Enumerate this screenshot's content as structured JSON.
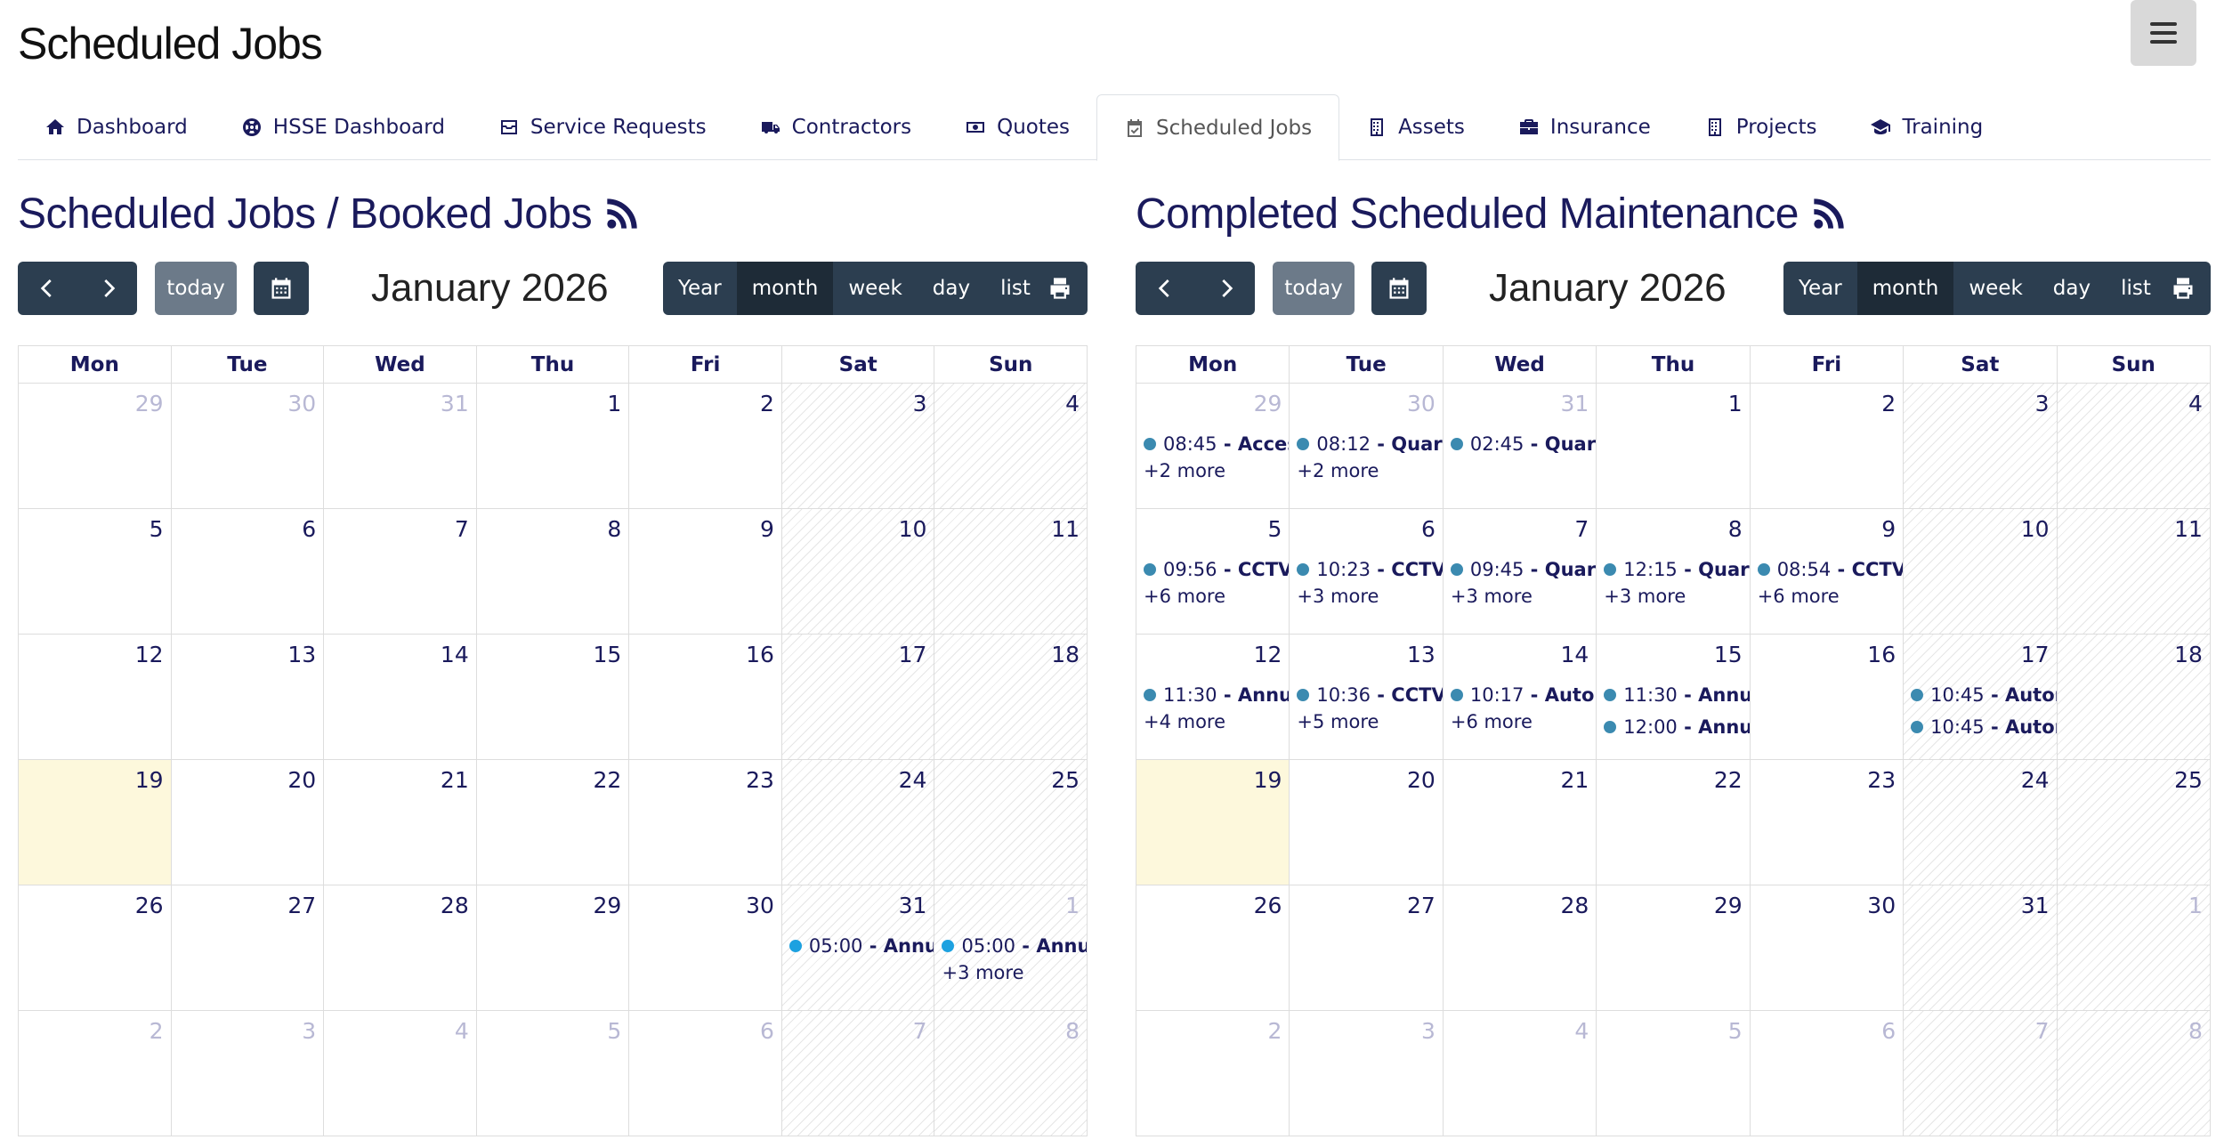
{
  "page": {
    "title": "Scheduled Jobs"
  },
  "nav": {
    "tabs": [
      {
        "label": "Dashboard",
        "icon": "home-icon"
      },
      {
        "label": "HSSE Dashboard",
        "icon": "lifebuoy-icon"
      },
      {
        "label": "Service Requests",
        "icon": "inbox-tray-icon"
      },
      {
        "label": "Contractors",
        "icon": "truck-icon"
      },
      {
        "label": "Quotes",
        "icon": "money-bill-icon"
      },
      {
        "label": "Scheduled Jobs",
        "icon": "calendar-check-icon",
        "active": true
      },
      {
        "label": "Assets",
        "icon": "building-icon"
      },
      {
        "label": "Insurance",
        "icon": "briefcase-icon"
      },
      {
        "label": "Projects",
        "icon": "building-icon"
      },
      {
        "label": "Training",
        "icon": "graduation-cap-icon"
      }
    ]
  },
  "calendars": [
    {
      "heading": "Scheduled Jobs / Booked Jobs",
      "today_label": "today",
      "title": "January 2026",
      "views": [
        "Year",
        "month",
        "week",
        "day",
        "list"
      ],
      "active_view": "month",
      "days_of_week": [
        "Mon",
        "Tue",
        "Wed",
        "Thu",
        "Fri",
        "Sat",
        "Sun"
      ],
      "weeks": [
        [
          {
            "n": "29",
            "o": true
          },
          {
            "n": "30",
            "o": true
          },
          {
            "n": "31",
            "o": true
          },
          {
            "n": "1"
          },
          {
            "n": "2"
          },
          {
            "n": "3"
          },
          {
            "n": "4"
          }
        ],
        [
          {
            "n": "5"
          },
          {
            "n": "6"
          },
          {
            "n": "7"
          },
          {
            "n": "8"
          },
          {
            "n": "9"
          },
          {
            "n": "10"
          },
          {
            "n": "11"
          }
        ],
        [
          {
            "n": "12"
          },
          {
            "n": "13"
          },
          {
            "n": "14"
          },
          {
            "n": "15"
          },
          {
            "n": "16"
          },
          {
            "n": "17"
          },
          {
            "n": "18"
          }
        ],
        [
          {
            "n": "19",
            "today": true
          },
          {
            "n": "20"
          },
          {
            "n": "21"
          },
          {
            "n": "22"
          },
          {
            "n": "23"
          },
          {
            "n": "24"
          },
          {
            "n": "25"
          }
        ],
        [
          {
            "n": "26"
          },
          {
            "n": "27"
          },
          {
            "n": "28"
          },
          {
            "n": "29"
          },
          {
            "n": "30"
          },
          {
            "n": "31",
            "events": [
              {
                "time": "05:00",
                "title": "Annual",
                "color": "blue"
              }
            ]
          },
          {
            "n": "1",
            "o": true,
            "events": [
              {
                "time": "05:00",
                "title": "Annual",
                "color": "blue"
              }
            ],
            "more": "+3 more"
          }
        ],
        [
          {
            "n": "2",
            "o": true
          },
          {
            "n": "3",
            "o": true
          },
          {
            "n": "4",
            "o": true
          },
          {
            "n": "5",
            "o": true
          },
          {
            "n": "6",
            "o": true
          },
          {
            "n": "7",
            "o": true
          },
          {
            "n": "8",
            "o": true
          }
        ]
      ]
    },
    {
      "heading": "Completed Scheduled Maintenance",
      "today_label": "today",
      "title": "January 2026",
      "views": [
        "Year",
        "month",
        "week",
        "day",
        "list"
      ],
      "active_view": "month",
      "days_of_week": [
        "Mon",
        "Tue",
        "Wed",
        "Thu",
        "Fri",
        "Sat",
        "Sun"
      ],
      "weeks": [
        [
          {
            "n": "29",
            "o": true,
            "events": [
              {
                "time": "08:45",
                "title": "Access"
              }
            ],
            "more": "+2 more"
          },
          {
            "n": "30",
            "o": true,
            "events": [
              {
                "time": "08:12",
                "title": "Quarte"
              }
            ],
            "more": "+2 more"
          },
          {
            "n": "31",
            "o": true,
            "events": [
              {
                "time": "02:45",
                "title": "Quarte"
              }
            ]
          },
          {
            "n": "1"
          },
          {
            "n": "2"
          },
          {
            "n": "3"
          },
          {
            "n": "4"
          }
        ],
        [
          {
            "n": "5",
            "events": [
              {
                "time": "09:56",
                "title": "CCTV"
              }
            ],
            "more": "+6 more"
          },
          {
            "n": "6",
            "events": [
              {
                "time": "10:23",
                "title": "CCTV"
              }
            ],
            "more": "+3 more"
          },
          {
            "n": "7",
            "events": [
              {
                "time": "09:45",
                "title": "Quarte"
              }
            ],
            "more": "+3 more"
          },
          {
            "n": "8",
            "events": [
              {
                "time": "12:15",
                "title": "Quarte"
              }
            ],
            "more": "+3 more"
          },
          {
            "n": "9",
            "events": [
              {
                "time": "08:54",
                "title": "CCTV"
              }
            ],
            "more": "+6 more"
          },
          {
            "n": "10"
          },
          {
            "n": "11"
          }
        ],
        [
          {
            "n": "12",
            "events": [
              {
                "time": "11:30",
                "title": "Annua"
              }
            ],
            "more": "+4 more"
          },
          {
            "n": "13",
            "events": [
              {
                "time": "10:36",
                "title": "CCTV"
              }
            ],
            "more": "+5 more"
          },
          {
            "n": "14",
            "events": [
              {
                "time": "10:17",
                "title": "Autom"
              }
            ],
            "more": "+6 more"
          },
          {
            "n": "15",
            "events": [
              {
                "time": "11:30",
                "title": "Annua"
              },
              {
                "time": "12:00",
                "title": "Annua"
              }
            ]
          },
          {
            "n": "16"
          },
          {
            "n": "17",
            "events": [
              {
                "time": "10:45",
                "title": "Autom"
              },
              {
                "time": "10:45",
                "title": "Autom"
              }
            ]
          },
          {
            "n": "18"
          }
        ],
        [
          {
            "n": "19",
            "today": true
          },
          {
            "n": "20"
          },
          {
            "n": "21"
          },
          {
            "n": "22"
          },
          {
            "n": "23"
          },
          {
            "n": "24"
          },
          {
            "n": "25"
          }
        ],
        [
          {
            "n": "26"
          },
          {
            "n": "27"
          },
          {
            "n": "28"
          },
          {
            "n": "29"
          },
          {
            "n": "30"
          },
          {
            "n": "31"
          },
          {
            "n": "1",
            "o": true
          }
        ],
        [
          {
            "n": "2",
            "o": true
          },
          {
            "n": "3",
            "o": true
          },
          {
            "n": "4",
            "o": true
          },
          {
            "n": "5",
            "o": true
          },
          {
            "n": "6",
            "o": true
          },
          {
            "n": "7",
            "o": true
          },
          {
            "n": "8",
            "o": true
          }
        ]
      ]
    }
  ],
  "colors": {
    "primary": "#2c3e50",
    "event_dot": "#3b8ab0",
    "event_dot_blue": "#1da1e0",
    "today_bg": "#fdf8dc",
    "text": "#1a1a5c"
  }
}
